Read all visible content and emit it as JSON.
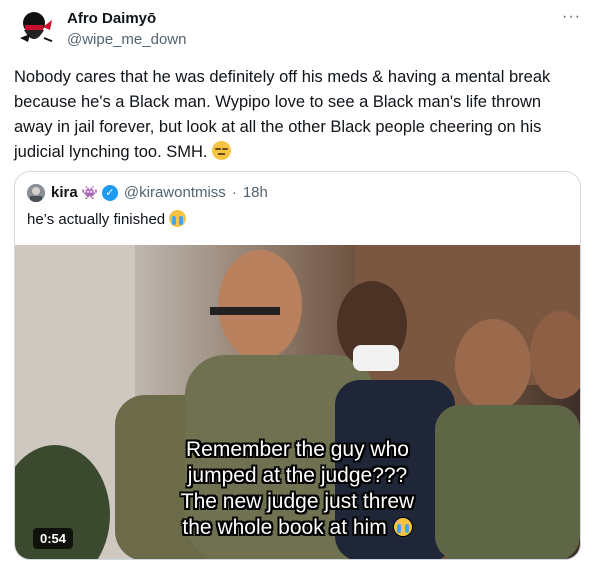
{
  "author": {
    "name": "Afro Daimyō",
    "handle": "@wipe_me_down",
    "avatar_icon": "afro-samurai-avatar"
  },
  "more_label": "···",
  "tweet_text": "Nobody cares that he was definitely off his meds & having a mental break because he's a Black man. Wypipo love to see a Black man's life thrown away in jail forever, but look at all the other Black people cheering on his judicial lynching too. SMH.",
  "tweet_emoji": "expressionless-face-emoji",
  "quoted": {
    "name": "kira",
    "name_emoji": "👾",
    "verified": true,
    "handle": "@kirawontmiss",
    "separator": "·",
    "time": "18h",
    "text": "he’s actually finished",
    "text_emoji": "loudly-crying-face-emoji",
    "media": {
      "caption_lines": [
        "Remember the guy who",
        "jumped at the judge???",
        "The new judge just threw",
        "the whole book at him"
      ],
      "caption_emoji": "loudly-crying-face-emoji",
      "duration": "0:54"
    }
  },
  "colors": {
    "text": "#0f1419",
    "secondary": "#536471",
    "border": "#cfd9de",
    "verified": "#1d9bf0"
  }
}
